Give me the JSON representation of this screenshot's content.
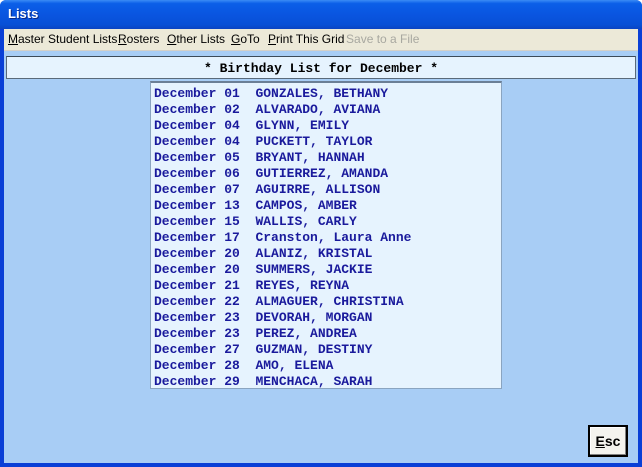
{
  "window": {
    "title": "Lists"
  },
  "menu": [
    {
      "label": "Master Student Lists",
      "name": "menu-master-student-lists",
      "enabled": true
    },
    {
      "label": "Rosters",
      "name": "menu-rosters",
      "enabled": true
    },
    {
      "label": "Other Lists",
      "name": "menu-other-lists",
      "enabled": true
    },
    {
      "label": "GoTo",
      "name": "menu-goto",
      "enabled": true
    },
    {
      "label": "Print This Grid",
      "name": "menu-print-this-grid",
      "enabled": true
    },
    {
      "label": "Save to a File",
      "name": "menu-save-to-a-file",
      "enabled": false
    }
  ],
  "header": {
    "text": "* Birthday List for December *"
  },
  "rows": [
    {
      "date": "December 01",
      "name": "GONZALES, BETHANY"
    },
    {
      "date": "December 02",
      "name": "ALVARADO, AVIANA"
    },
    {
      "date": "December 04",
      "name": "GLYNN, EMILY"
    },
    {
      "date": "December 04",
      "name": "PUCKETT, TAYLOR"
    },
    {
      "date": "December 05",
      "name": "BRYANT, HANNAH"
    },
    {
      "date": "December 06",
      "name": "GUTIERREZ, AMANDA"
    },
    {
      "date": "December 07",
      "name": "AGUIRRE, ALLISON"
    },
    {
      "date": "December 13",
      "name": "CAMPOS, AMBER"
    },
    {
      "date": "December 15",
      "name": "WALLIS, CARLY"
    },
    {
      "date": "December 17",
      "name": "Cranston, Laura Anne"
    },
    {
      "date": "December 20",
      "name": "ALANIZ, KRISTAL"
    },
    {
      "date": "December 20",
      "name": "SUMMERS, JACKIE"
    },
    {
      "date": "December 21",
      "name": "REYES, REYNA"
    },
    {
      "date": "December 22",
      "name": "ALMAGUER, CHRISTINA"
    },
    {
      "date": "December 23",
      "name": "DEVORAH, MORGAN"
    },
    {
      "date": "December 23",
      "name": "PEREZ, ANDREA"
    },
    {
      "date": "December 27",
      "name": "GUZMAN, DESTINY"
    },
    {
      "date": "December 28",
      "name": "AMO, ELENA"
    },
    {
      "date": "December 29",
      "name": "MENCHACA, SARAH"
    }
  ],
  "esc_button": {
    "label": "Esc"
  },
  "colors": {
    "background": "#a8cdf5",
    "list_text": "#1a1a9c",
    "titlebar": "#0a55e0"
  }
}
